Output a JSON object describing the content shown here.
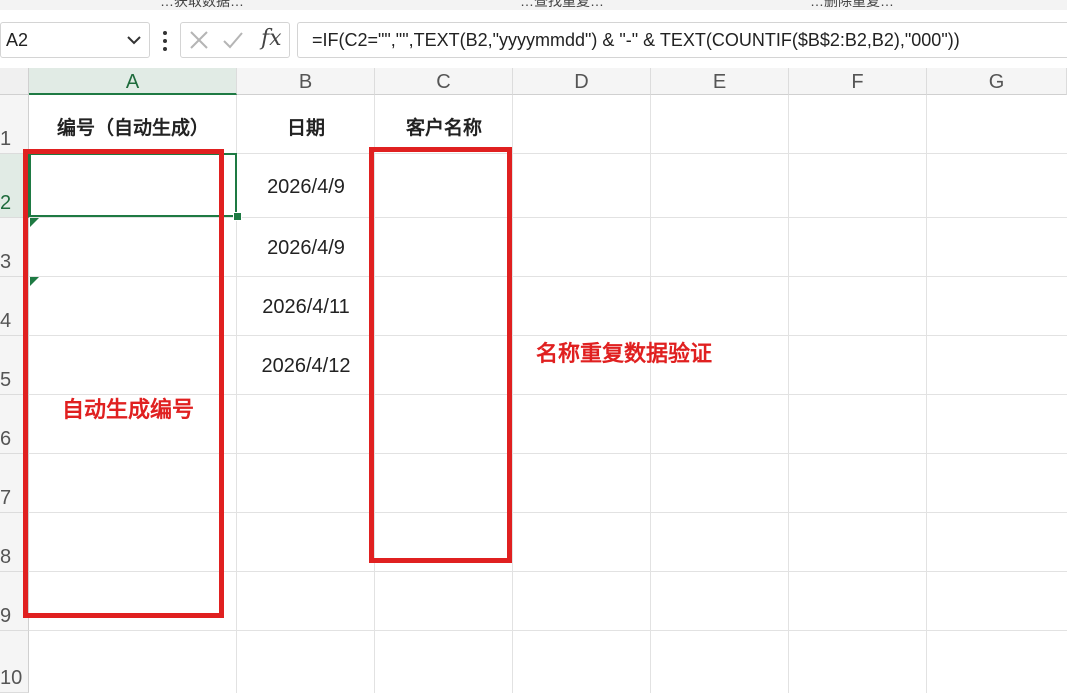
{
  "ribbon": {
    "fragments": [
      "…获取数据…",
      "…查找重复…",
      "…删除重复…"
    ]
  },
  "formula_bar": {
    "name_box": "A2",
    "formula": "=IF(C2=\"\",\"\",TEXT(B2,\"yyyymmdd\") & \"-\" & TEXT(COUNTIF($B$2:B2,B2),\"000\"))",
    "fx_label": "fx"
  },
  "grid": {
    "columns": [
      "A",
      "B",
      "C",
      "D",
      "E",
      "F",
      "G"
    ],
    "rows": [
      "1",
      "2",
      "3",
      "4",
      "5",
      "6",
      "7",
      "8",
      "9",
      "10"
    ],
    "active_column": "A",
    "active_row": "2",
    "headers": {
      "A1": "编号（自动生成）",
      "B1": "日期",
      "C1": "客户名称"
    },
    "dates": [
      "2026/4/9",
      "2026/4/9",
      "2026/4/11",
      "2026/4/12"
    ]
  },
  "annotations": {
    "left": "自动生成编号",
    "right": "名称重复数据验证",
    "color": "#e02020"
  },
  "colors": {
    "accent": "#1e7a43",
    "annotation": "#e02020"
  }
}
